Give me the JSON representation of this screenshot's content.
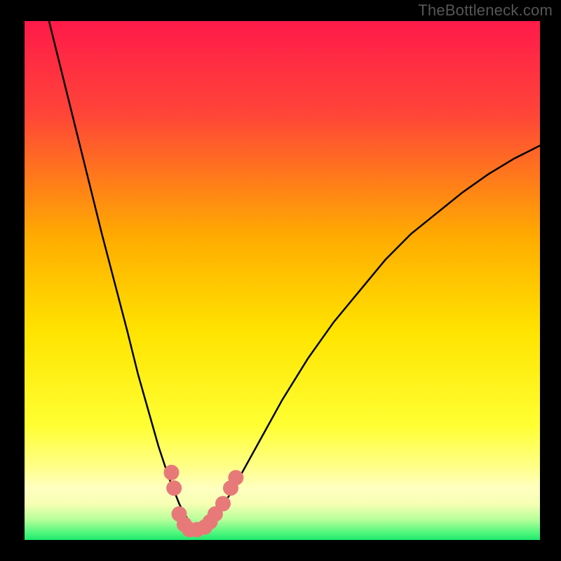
{
  "watermark": "TheBottleneck.com",
  "chart_data": {
    "type": "line",
    "title": "",
    "xlabel": "",
    "ylabel": "",
    "xlim": [
      0,
      100
    ],
    "ylim": [
      0,
      100
    ],
    "background_gradient": {
      "top": "#ff1a4a",
      "mid1": "#ffad00",
      "mid2": "#ffff33",
      "band": "#ffffa5",
      "bottom": "#1eea6e"
    },
    "series": [
      {
        "name": "bottleneck-curve",
        "x": [
          0,
          5,
          10,
          15,
          20,
          22,
          24,
          26,
          28,
          30,
          31,
          32,
          33,
          34,
          35,
          36,
          38,
          40,
          45,
          50,
          55,
          60,
          65,
          70,
          75,
          80,
          85,
          90,
          95,
          100
        ],
        "values": [
          120,
          99,
          79,
          59,
          40,
          32,
          25,
          18,
          12,
          7,
          5,
          3.5,
          2.5,
          2,
          2.5,
          3.5,
          6,
          9,
          18,
          27,
          35,
          42,
          48,
          54,
          59,
          63,
          67,
          70.5,
          73.5,
          76
        ]
      }
    ],
    "markers": [
      {
        "x": 28.5,
        "y": 13
      },
      {
        "x": 29.0,
        "y": 10
      },
      {
        "x": 30.0,
        "y": 5
      },
      {
        "x": 31.0,
        "y": 3
      },
      {
        "x": 32.0,
        "y": 2
      },
      {
        "x": 33.5,
        "y": 2
      },
      {
        "x": 35.0,
        "y": 2.5
      },
      {
        "x": 36.0,
        "y": 3.5
      },
      {
        "x": 37.0,
        "y": 5
      },
      {
        "x": 38.5,
        "y": 7
      },
      {
        "x": 40.0,
        "y": 10
      },
      {
        "x": 41.0,
        "y": 12
      }
    ],
    "marker_color": "#e77a78",
    "marker_radius": 11
  }
}
